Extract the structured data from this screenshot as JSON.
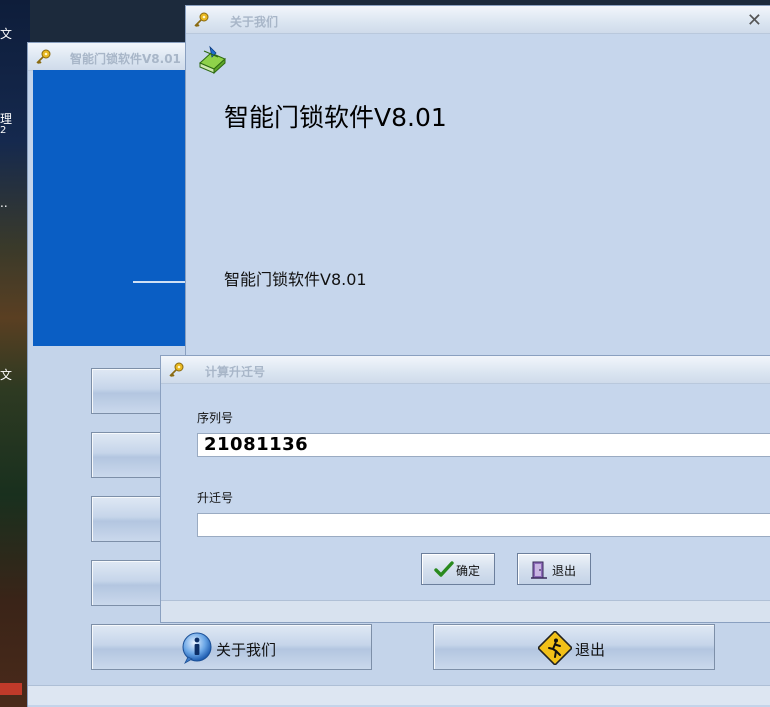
{
  "desktop": {
    "icon_labels": [
      "文",
      "理",
      "2",
      "..",
      "文"
    ]
  },
  "main_window": {
    "title": "智能门锁软件V8.01",
    "about_button_label": "关于我们",
    "exit_button_label": "退出"
  },
  "about_window": {
    "title": "关于我们",
    "close_glyph": "✕",
    "product_name_large": "智能门锁软件V8.01",
    "product_name_small": "智能门锁软件V8.01"
  },
  "migrate_window": {
    "title": "计算升迁号",
    "serial_label": "序列号",
    "serial_value": "21081136",
    "migrate_label": "升迁号",
    "migrate_value": "",
    "ok_button_label": "确定",
    "exit_button_label": "退出"
  },
  "icons": {
    "title_icon": "key-icon",
    "about": "info-icon",
    "exit": "exit-sign-icon",
    "ok": "checkmark-icon",
    "quit": "door-exit-icon",
    "app": "app-book-icon"
  },
  "colors": {
    "window_bg": "#c4d4ea",
    "main_panel_blue": "#0a5ec4",
    "title_text": "#a8b6c8"
  }
}
